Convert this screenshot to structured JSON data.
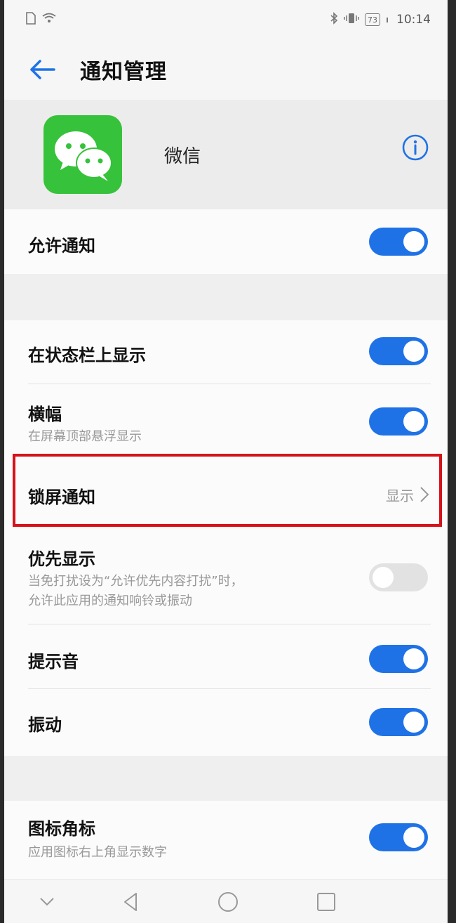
{
  "status_bar": {
    "battery": "73",
    "time": "10:14"
  },
  "header": {
    "title": "通知管理"
  },
  "app": {
    "name": "微信"
  },
  "rows": {
    "allow_notifications": {
      "title": "允许通知",
      "enabled": true
    },
    "status_bar_display": {
      "title": "在状态栏上显示",
      "enabled": true
    },
    "banner": {
      "title": "横幅",
      "subtitle": "在屏幕顶部悬浮显示",
      "enabled": true
    },
    "lock_screen": {
      "title": "锁屏通知",
      "value": "显示"
    },
    "priority": {
      "title": "优先显示",
      "subtitle_line1": "当免打扰设为“允许优先内容打扰”时，",
      "subtitle_line2": "允许此应用的通知响铃或振动",
      "enabled": false
    },
    "sound": {
      "title": "提示音",
      "enabled": true
    },
    "vibration": {
      "title": "振动",
      "enabled": true
    },
    "badge": {
      "title": "图标角标",
      "subtitle": "应用图标右上角显示数字",
      "enabled": true
    }
  },
  "colors": {
    "accent": "#1f72e6",
    "highlight": "#d6121a",
    "wechat_green": "#36c23a"
  }
}
